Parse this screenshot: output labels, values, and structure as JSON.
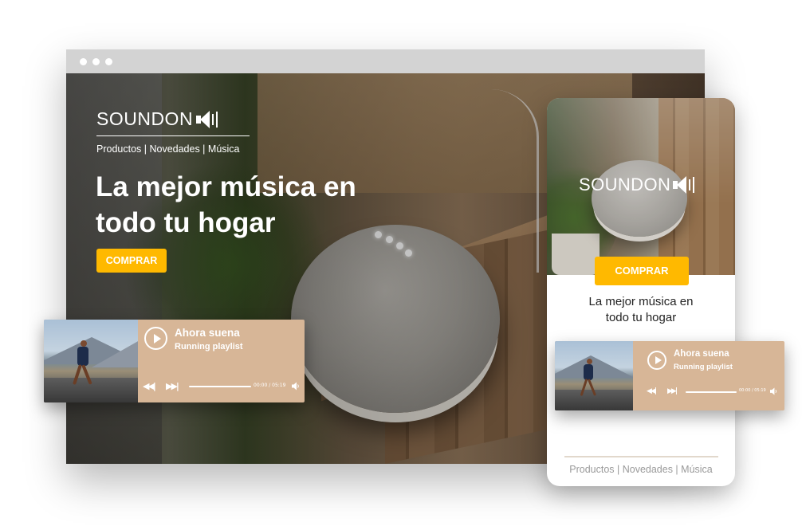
{
  "brand": {
    "name": "SOUNDON",
    "logo_icon": "speaker-icon"
  },
  "desktop": {
    "nav": "Productos | Novedades | Música",
    "headline_line1": "La mejor música en",
    "headline_line2": "todo tu hogar",
    "buy_label": "COMPRAR",
    "player": {
      "now_playing": "Ahora suena",
      "playlist": "Running playlist",
      "time": "00:00 / 05:19",
      "progress": 0.85
    }
  },
  "mobile": {
    "buy_label": "COMPRAR",
    "headline_line1": "La mejor música en",
    "headline_line2": "todo tu hogar",
    "player": {
      "now_playing": "Ahora suena",
      "playlist": "Running playlist",
      "time": "00:00 / 05:19",
      "progress": 0.85
    },
    "nav": "Productos | Novedades | Música"
  },
  "colors": {
    "accent": "#ffb900",
    "player_bg": "#d7b697",
    "text_light": "#ffffff",
    "nav_gray": "#9a9a9a"
  },
  "icons": [
    "play-icon",
    "rewind-icon",
    "fast-forward-icon",
    "volume-icon",
    "speaker-icon"
  ]
}
